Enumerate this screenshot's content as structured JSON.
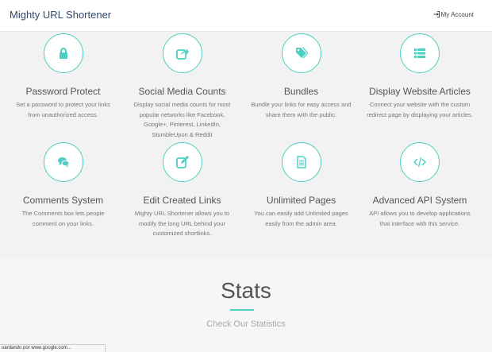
{
  "header": {
    "brand": "Mighty URL Shortener",
    "account_label": "My Account"
  },
  "features": [
    {
      "title": "Password Protect",
      "icon": "lock-icon",
      "desc": "Set a password to protect your links from unauthorized access."
    },
    {
      "title": "Social Media Counts",
      "icon": "share-icon",
      "desc": "Display social media counts for most popular networks like Facebook, Google+, Pinterest, LinkedIn, StumbleUpon & Reddit"
    },
    {
      "title": "Bundles",
      "icon": "tags-icon",
      "desc": "Bundle your links for easy access and share them with the public."
    },
    {
      "title": "Display Website Articles",
      "icon": "list-icon",
      "desc": "Connect your website with the custom redirect page by displaying your articles."
    },
    {
      "title": "Comments System",
      "icon": "comments-icon",
      "desc": "The Comments box lets people comment on your links."
    },
    {
      "title": "Edit Created Links",
      "icon": "edit-icon",
      "desc": "Mighty URL Shortener allows you to modify the long URL behind your customized shortlinks."
    },
    {
      "title": "Unlimited Pages",
      "icon": "file-icon",
      "desc": "You can easily add Unlimited pages easily from the admin area."
    },
    {
      "title": "Advanced API System",
      "icon": "code-icon",
      "desc": "API allows you to develop applications that interface with this service."
    }
  ],
  "stats": {
    "title": "Stats",
    "subtitle": "Check Our Statistics"
  },
  "status_bar": {
    "text": "uardando por www.google.com..."
  },
  "colors": {
    "accent": "#4ecfc3",
    "brand": "#2f4a6b"
  }
}
